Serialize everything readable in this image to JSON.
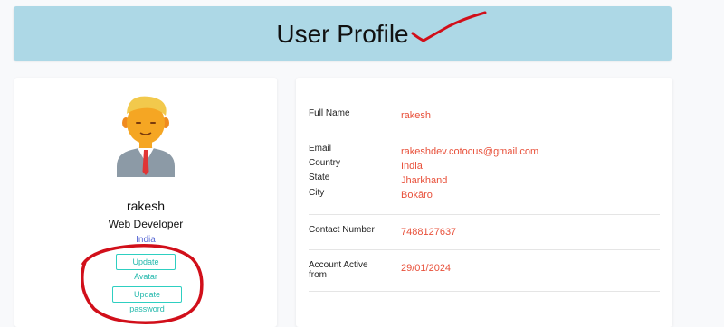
{
  "header": {
    "title": "User Profile"
  },
  "profile": {
    "avatar_icon": "user-avatar-icon",
    "name": "rakesh",
    "role": "Web Developer",
    "country": "India",
    "update_avatar_label": "Update Avatar",
    "update_password_label": "Update password"
  },
  "details": {
    "full_name_label": "Full Name",
    "full_name_value": "rakesh",
    "email_label": "Email",
    "email_value": "rakeshdev.cotocus@gmail.com",
    "country_label": "Country",
    "country_value": "India",
    "state_label": "State",
    "state_value": "Jharkhand",
    "city_label": "City",
    "city_value": "Bokāro",
    "contact_label": "Contact Number",
    "contact_value": "7488127637",
    "account_active_label_line1": "Account Active",
    "account_active_label_line2": "from",
    "account_active_value": "29/01/2024"
  },
  "colors": {
    "header_bg": "#add8e6",
    "value_text": "#e8503a",
    "button_accent": "#2ecfc1",
    "annotation_red": "#d10f1a",
    "country_text": "#5b6bd5"
  }
}
